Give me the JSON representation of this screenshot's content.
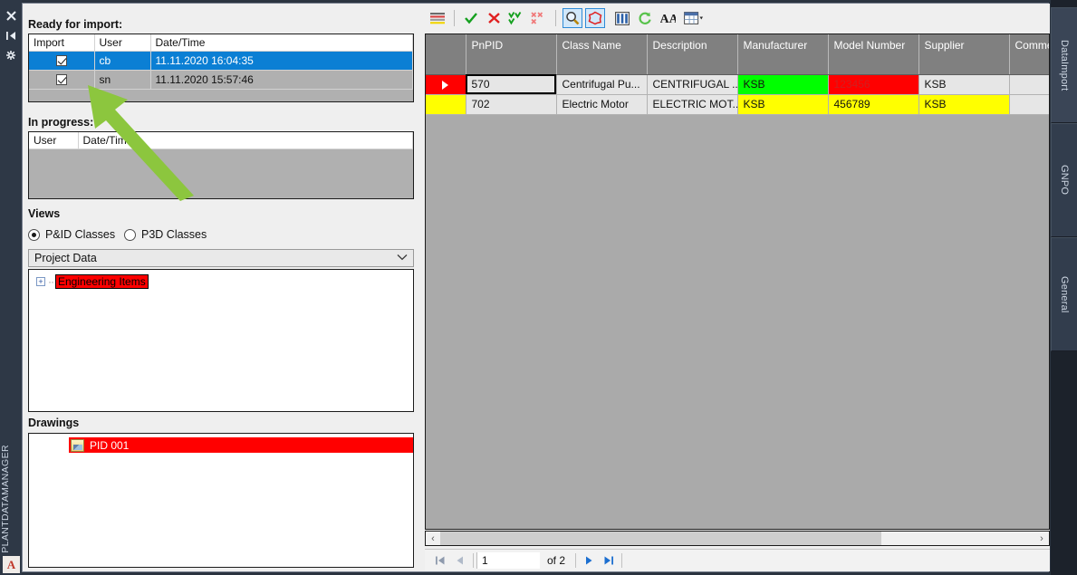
{
  "window": {
    "rail_title": "PLANTDATAMANAGER",
    "logo_letter": "A",
    "rail_icons": [
      {
        "name": "close-icon",
        "glyph": "✖"
      },
      {
        "name": "auto-hide-pin-icon",
        "glyph": "▶|"
      },
      {
        "name": "panel-menu-icon",
        "glyph": "✻"
      }
    ],
    "vertical_tabs": [
      {
        "label": "DataImport",
        "active": true
      },
      {
        "label": "GNPO",
        "active": false
      },
      {
        "label": "General",
        "active": false
      }
    ]
  },
  "left_panel": {
    "ready_label": "Ready for import:",
    "ready_table": {
      "columns": [
        "Import",
        "User",
        "Date/Time"
      ],
      "rows": [
        {
          "import": true,
          "user": "cb",
          "datetime": "11.11.2020 16:04:35",
          "selected": true
        },
        {
          "import": true,
          "user": "sn",
          "datetime": "11.11.2020 15:57:46",
          "selected": false
        }
      ]
    },
    "inprogress_label": "In progress:",
    "inprogress_table": {
      "columns": [
        "User",
        "Date/Tim"
      ],
      "rows": []
    },
    "views_label": "Views",
    "view_options": [
      {
        "label": "P&ID Classes",
        "selected": true
      },
      {
        "label": "P3D Classes",
        "selected": false
      }
    ],
    "data_source": {
      "value": "Project Data",
      "caret": "⌄"
    },
    "tree": {
      "nodes": [
        {
          "label": "Engineering Items",
          "expander": "+",
          "highlighted": true
        }
      ]
    },
    "drawings_label": "Drawings",
    "drawings": [
      {
        "label": "PID 001",
        "selected": true
      }
    ]
  },
  "right_panel": {
    "toolbar": [
      {
        "name": "legend-button",
        "glyph": "≡",
        "pressed": false
      },
      {
        "name": "sep-1",
        "glyph": "|",
        "pressed": false
      },
      {
        "name": "accept-button",
        "glyph": "✔",
        "pressed": false
      },
      {
        "name": "reject-button",
        "glyph": "✖",
        "pressed": false
      },
      {
        "name": "accept-all-button",
        "glyph": "✔✔",
        "pressed": false
      },
      {
        "name": "reject-all-button",
        "glyph": "✖✖",
        "pressed": false
      },
      {
        "name": "sep-2",
        "glyph": "|",
        "pressed": false
      },
      {
        "name": "zoom-to-object-button",
        "glyph": "ὐD",
        "pressed": true
      },
      {
        "name": "highlight-object-button",
        "glyph": "⬡",
        "pressed": true
      },
      {
        "name": "columns-button",
        "glyph": "▐▐",
        "pressed": false
      },
      {
        "name": "refresh-button",
        "glyph": "↻",
        "pressed": false
      },
      {
        "name": "find-button",
        "glyph": "AA",
        "pressed": false
      },
      {
        "name": "export-table-button",
        "glyph": "▦",
        "pressed": false
      }
    ],
    "grid": {
      "columns": [
        "",
        "PnPID",
        "Class Name",
        "Description",
        "Manufacturer",
        "Model Number",
        "Supplier",
        "Commen"
      ],
      "rows": [
        {
          "indicator": "▶",
          "indicator_color": "#ff0000",
          "cells": [
            {
              "value": "570",
              "bg": "#e6e6e6",
              "fg": "#111111",
              "focused": true
            },
            {
              "value": "Centrifugal Pu...",
              "bg": "#e6e6e6",
              "fg": "#111111",
              "focused": false
            },
            {
              "value": "CENTRIFUGAL ...",
              "bg": "#e6e6e6",
              "fg": "#111111",
              "focused": false
            },
            {
              "value": "KSB",
              "bg": "#00ff00",
              "fg": "#111111",
              "focused": false
            },
            {
              "value": "123456",
              "bg": "#ff0000",
              "fg": "#cc2222",
              "focused": false
            },
            {
              "value": "KSB",
              "bg": "#e6e6e6",
              "fg": "#111111",
              "focused": false
            },
            {
              "value": "",
              "bg": "#e6e6e6",
              "fg": "#111111",
              "focused": false
            }
          ]
        },
        {
          "indicator": "",
          "indicator_color": "#ffff00",
          "cells": [
            {
              "value": "702",
              "bg": "#e6e6e6",
              "fg": "#111111",
              "focused": false
            },
            {
              "value": "Electric Motor",
              "bg": "#e6e6e6",
              "fg": "#111111",
              "focused": false
            },
            {
              "value": "ELECTRIC MOT...",
              "bg": "#e6e6e6",
              "fg": "#111111",
              "focused": false
            },
            {
              "value": "KSB",
              "bg": "#ffff00",
              "fg": "#111111",
              "focused": false
            },
            {
              "value": "456789",
              "bg": "#ffff00",
              "fg": "#111111",
              "focused": false
            },
            {
              "value": "KSB",
              "bg": "#ffff00",
              "fg": "#111111",
              "focused": false
            },
            {
              "value": "",
              "bg": "#e6e6e6",
              "fg": "#111111",
              "focused": false
            }
          ]
        }
      ]
    },
    "hscroll": {
      "left_arrow": "‹",
      "right_arrow": "›"
    },
    "pager": {
      "first": "◀|",
      "prev": "◀",
      "page_value": "1",
      "of_label": "of 2",
      "next": "▶",
      "last": "|▶"
    }
  },
  "annotation": {
    "arrow_color": "#8cc63e"
  }
}
